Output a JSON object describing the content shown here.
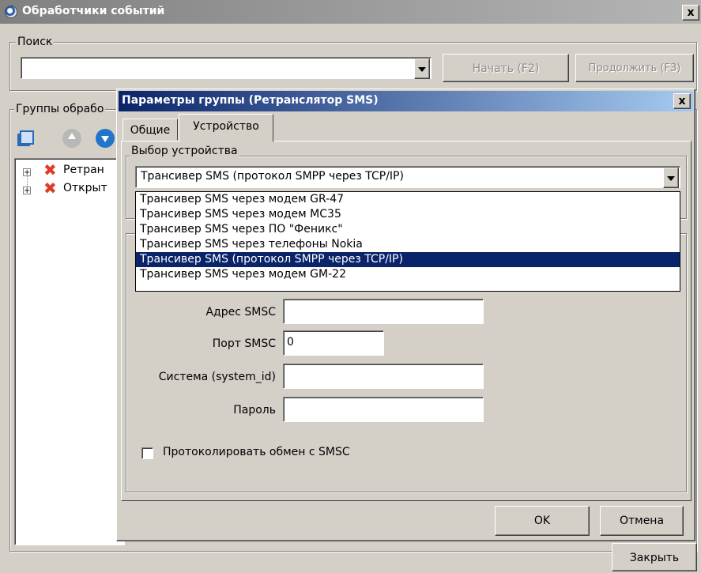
{
  "main_window": {
    "title": "Обработчики событий",
    "close_label": "x",
    "search": {
      "legend": "Поиск",
      "value": "",
      "start_label": "Начать (F2)",
      "continue_label": "Продолжить (F3)"
    },
    "groups": {
      "legend": "Группы обрабо",
      "tree": [
        {
          "label": "Ретран"
        },
        {
          "label": "Открыт"
        }
      ]
    },
    "close_button": "Закрыть"
  },
  "dialog": {
    "title": "Параметры группы (Ретранслятор SMS)",
    "close_label": "x",
    "tabs": [
      {
        "label": "Общие",
        "active": false
      },
      {
        "label": "Устройство",
        "active": true
      }
    ],
    "device_group": {
      "legend": "Выбор устройства",
      "selected": "Трансивер SMS (протокол SMPP через TCP/IP)",
      "options": [
        "Трансивер SMS через модем GR-47",
        "Трансивер SMS через модем MC35",
        "Трансивер SMS через ПО \"Феникс\"",
        "Трансивер SMS через телефоны Nokia",
        "Трансивер SMS (протокол SMPP через TCP/IP)",
        "Трансивер SMS через модем GM-22"
      ],
      "selected_index": 4
    },
    "fields": {
      "smsc_address_label": "Адрес SMSC",
      "smsc_address_value": "",
      "smsc_port_label": "Порт SMSC",
      "smsc_port_value": "0",
      "system_id_label": "Система (system_id)",
      "system_id_value": "",
      "password_label": "Пароль",
      "password_value": ""
    },
    "log_checkbox": {
      "label": "Протоколировать обмен с SMSC",
      "checked": false
    },
    "ok_label": "OK",
    "cancel_label": "Отмена"
  },
  "colors": {
    "face": "#d4d0c8",
    "selection": "#0a246a",
    "title_active": "#0a246a",
    "title_inactive": "#808080"
  }
}
